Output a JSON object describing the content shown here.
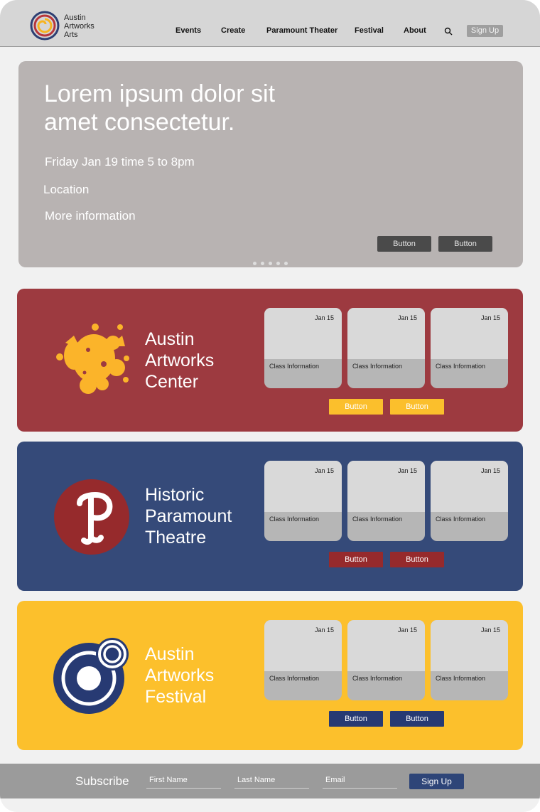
{
  "header": {
    "brand_lines": [
      "Austin",
      "Artworks",
      "Arts"
    ],
    "nav": [
      "Events",
      "Create",
      "Paramount Theater",
      "Festival",
      "About"
    ],
    "signup_label": "Sign Up"
  },
  "hero": {
    "title_lines": [
      "Lorem ipsum dolor sit",
      "amet consectetur."
    ],
    "datetime": "Friday Jan 19 time 5 to 8pm",
    "location": "Location",
    "more_info": "More information",
    "buttons": [
      "Button",
      "Button"
    ],
    "carousel_dots": 5
  },
  "sections": [
    {
      "name_lines": [
        "Austin",
        "Artworks",
        "Center"
      ],
      "background": "#9d3a40",
      "text_color": "#ffffff",
      "button_color": "#fbbf2c",
      "button_text_color": "#ffffff",
      "logo_icon": "paint-splat-icon",
      "cards": [
        {
          "date": "Jan 15",
          "info": "Class Information"
        },
        {
          "date": "Jan 15",
          "info": "Class Information"
        },
        {
          "date": "Jan 15",
          "info": "Class Information"
        }
      ],
      "buttons": [
        "Button",
        "Button"
      ]
    },
    {
      "name_lines": [
        "Historic",
        "Paramount",
        "Theatre"
      ],
      "background": "#354a79",
      "text_color": "#ffffff",
      "button_color": "#962a2c",
      "button_text_color": "#ffffff",
      "logo_icon": "paramount-p-icon",
      "cards": [
        {
          "date": "Jan 15",
          "info": "Class Information"
        },
        {
          "date": "Jan 15",
          "info": "Class Information"
        },
        {
          "date": "Jan 15",
          "info": "Class Information"
        }
      ],
      "buttons": [
        "Button",
        "Button"
      ]
    },
    {
      "name_lines": [
        "Austin",
        "Artworks",
        "Festival"
      ],
      "background": "#fcc02c",
      "text_color": "#ffffff",
      "button_color": "#273a73",
      "button_text_color": "#ffffff",
      "logo_icon": "festival-circles-icon",
      "cards": [
        {
          "date": "Jan 15",
          "info": "Class Information"
        },
        {
          "date": "Jan 15",
          "info": "Class Information"
        },
        {
          "date": "Jan 15",
          "info": "Class Information"
        }
      ],
      "buttons": [
        "Button",
        "Button"
      ]
    }
  ],
  "footer": {
    "subscribe_label": "Subscribe",
    "first_name_placeholder": "First Name",
    "last_name_placeholder": "Last Name",
    "email_placeholder": "Email",
    "signup_label": "Sign Up"
  }
}
